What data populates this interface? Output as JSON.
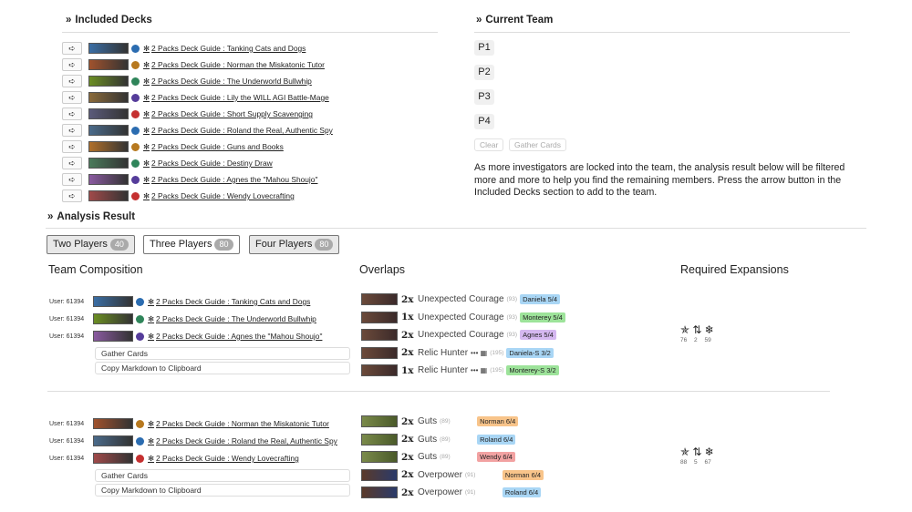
{
  "included_decks": {
    "heading": "Included Decks",
    "go_icon": "➪",
    "decks": [
      {
        "title": "2 Packs Deck Guide : Tanking Cats and Dogs",
        "color": "#2b6cb0",
        "thumb": "#3a6ea5"
      },
      {
        "title": "2 Packs Deck Guide : Norman the Miskatonic Tutor",
        "color": "#b7791f",
        "thumb": "#a0522d"
      },
      {
        "title": "2 Packs Deck Guide : The Underworld Bullwhip",
        "color": "#2f855a",
        "thumb": "#6b8e23"
      },
      {
        "title": "2 Packs Deck Guide : Lily the WILL AGI Battle-Mage",
        "color": "#553c9a",
        "thumb": "#8a6a3a"
      },
      {
        "title": "2 Packs Deck Guide : Short Supply Scavenging",
        "color": "#c53030",
        "thumb": "#5a5a7a"
      },
      {
        "title": "2 Packs Deck Guide : Roland the Real, Authentic Spy",
        "color": "#2b6cb0",
        "thumb": "#4a6a8a"
      },
      {
        "title": "2 Packs Deck Guide : Guns and Books",
        "color": "#b7791f",
        "thumb": "#b0702a"
      },
      {
        "title": "2 Packs Deck Guide : Destiny Draw",
        "color": "#2f855a",
        "thumb": "#4a7a5a"
      },
      {
        "title": "2 Packs Deck Guide : Agnes the \"Mahou Shoujo\"",
        "color": "#553c9a",
        "thumb": "#8a5aa0"
      },
      {
        "title": "2 Packs Deck Guide : Wendy Lovecrafting",
        "color": "#c53030",
        "thumb": "#a04a4a"
      }
    ]
  },
  "current_team": {
    "heading": "Current Team",
    "slots": [
      "P1",
      "P2",
      "P3",
      "P4"
    ],
    "clear_label": "Clear",
    "gather_label": "Gather Cards",
    "note": "As more investigators are locked into the team, the analysis result below will be filtered more and more to help you find the remaining members. Press the arrow button in the Included Decks section to add to the team."
  },
  "analysis": {
    "heading": "Analysis Result",
    "tabs": [
      {
        "label": "Two Players",
        "count": "40"
      },
      {
        "label": "Three Players",
        "count": "80"
      },
      {
        "label": "Four Players",
        "count": "80"
      }
    ],
    "col_team": "Team Composition",
    "col_overlaps": "Overlaps",
    "col_expansions": "Required Expansions",
    "gather_label": "Gather Cards",
    "copy_label": "Copy Markdown to Clipboard",
    "results": [
      {
        "members": [
          {
            "user": "User: 61394",
            "title": "2 Packs Deck Guide : Tanking Cats and Dogs",
            "color": "#2b6cb0",
            "thumb": "#3a6ea5"
          },
          {
            "user": "User: 61394",
            "title": "2 Packs Deck Guide : The Underworld Bullwhip",
            "color": "#2f855a",
            "thumb": "#6b8e23"
          },
          {
            "user": "User: 61394",
            "title": "2 Packs Deck Guide : Agnes the \"Mahou Shoujo\"",
            "color": "#553c9a",
            "thumb": "#8a5aa0"
          }
        ],
        "overlaps": [
          {
            "qty": "2x",
            "name": "Unexpected Courage",
            "level": "(93)",
            "badge": "Daniela 5/4",
            "badge_color": "blue",
            "dots": ""
          },
          {
            "qty": "1x",
            "name": "Unexpected Courage",
            "level": "(93)",
            "badge": "Monterey 5/4",
            "badge_color": "green",
            "dots": ""
          },
          {
            "qty": "2x",
            "name": "Unexpected Courage",
            "level": "(93)",
            "badge": "Agnes 5/4",
            "badge_color": "purple",
            "dots": ""
          },
          {
            "qty": "2x",
            "name": "Relic Hunter",
            "level": "(195)",
            "badge": "Daniela-S 3/2",
            "badge_color": "blue",
            "dots": "••• ▦"
          },
          {
            "qty": "1x",
            "name": "Relic Hunter",
            "level": "(195)",
            "badge": "Monterey-S 3/2",
            "badge_color": "green",
            "dots": "••• ▦"
          }
        ],
        "expansion_icons": "✯ ⇅ ❄",
        "expansion_nums": "76 2 59"
      },
      {
        "members": [
          {
            "user": "User: 61394",
            "title": "2 Packs Deck Guide : Norman the Miskatonic Tutor",
            "color": "#b7791f",
            "thumb": "#a0522d"
          },
          {
            "user": "User: 61394",
            "title": "2 Packs Deck Guide : Roland the Real, Authentic Spy",
            "color": "#2b6cb0",
            "thumb": "#4a6a8a"
          },
          {
            "user": "User: 61394",
            "title": "2 Packs Deck Guide : Wendy Lovecrafting",
            "color": "#c53030",
            "thumb": "#a04a4a"
          }
        ],
        "overlaps": [
          {
            "qty": "2x",
            "name": "Guts",
            "level": "(89)",
            "badge": "Norman 6/4",
            "badge_color": "orange",
            "dots": ""
          },
          {
            "qty": "2x",
            "name": "Guts",
            "level": "(89)",
            "badge": "Roland 6/4",
            "badge_color": "blue",
            "dots": ""
          },
          {
            "qty": "2x",
            "name": "Guts",
            "level": "(89)",
            "badge": "Wendy 6/4",
            "badge_color": "red",
            "dots": ""
          },
          {
            "qty": "2x",
            "name": "Overpower",
            "level": "(91)",
            "badge": "Norman 6/4",
            "badge_color": "orange",
            "dots": ""
          },
          {
            "qty": "2x",
            "name": "Overpower",
            "level": "(91)",
            "badge": "Roland 6/4",
            "badge_color": "blue",
            "dots": ""
          }
        ],
        "expansion_icons": "✯ ⇅ ❄",
        "expansion_nums": "88 5 67"
      }
    ]
  }
}
